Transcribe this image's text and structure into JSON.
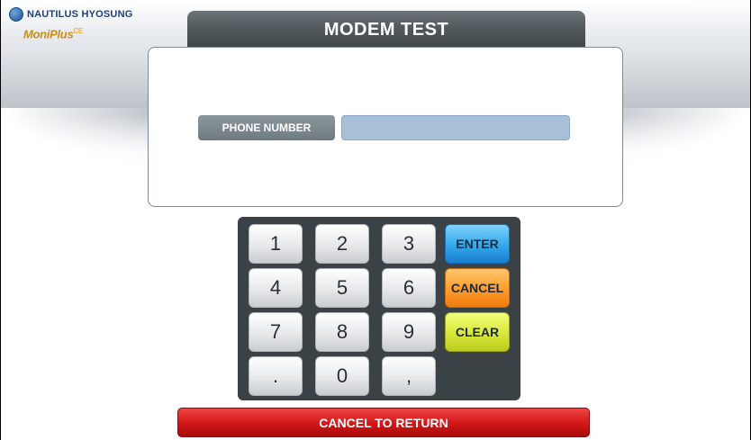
{
  "brand": {
    "company": "NAUTILUS HYOSUNG",
    "product": "MoniPlus",
    "product_suffix": "CE"
  },
  "screen": {
    "title": "MODEM TEST"
  },
  "form": {
    "phone_label": "PHONE NUMBER",
    "phone_value": ""
  },
  "keypad": {
    "digits": {
      "k1": "1",
      "k2": "2",
      "k3": "3",
      "k4": "4",
      "k5": "5",
      "k6": "6",
      "k7": "7",
      "k8": "8",
      "k9": "9",
      "dot": ".",
      "k0": "0",
      "comma": ","
    },
    "enter_label": "ENTER",
    "cancel_label": "CANCEL",
    "clear_label": "CLEAR"
  },
  "footer": {
    "cancel_return_label": "CANCEL TO RETURN"
  },
  "colors": {
    "title_bar": "#4f575b",
    "input_field": "#a7c0d8",
    "enter": "#33a7ea",
    "cancel": "#ff9b2b",
    "clear": "#d8e83a",
    "cancel_to_return": "#d11616"
  }
}
